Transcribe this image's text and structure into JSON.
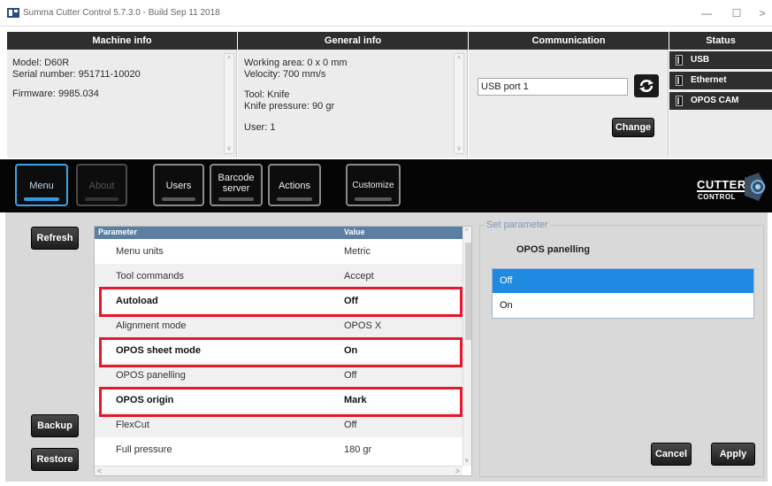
{
  "window": {
    "title": "Summa Cutter Control 5.7.3.0 - Build Sep 11 2018",
    "controls": {
      "minimize": "—",
      "maximize": "☐",
      "close": ">"
    }
  },
  "panels": {
    "machine_info": {
      "header": "Machine info",
      "model": "Model: D60R",
      "serial": "Serial number: 951711-10020",
      "firmware": "Firmware: 9985.034"
    },
    "general_info": {
      "header": "General info",
      "working_area": "Working area: 0 x 0 mm",
      "velocity": "Velocity: 700 mm/s",
      "tool": "Tool: Knife",
      "knife_pressure": "Knife pressure: 90 gr",
      "user": "User: 1"
    },
    "communication": {
      "header": "Communication",
      "port_value": "USB port 1",
      "change_label": "Change"
    },
    "status": {
      "header": "Status",
      "items": [
        "USB",
        "Ethernet",
        "OPOS CAM"
      ]
    }
  },
  "toolbar": {
    "buttons": {
      "menu": "Menu",
      "about": "About",
      "users": "Users",
      "barcode_line1": "Barcode",
      "barcode_line2": "server",
      "actions": "Actions",
      "customize": "Customize"
    },
    "logo_line1": "CUTTER",
    "logo_line2": "CONTROL"
  },
  "side_buttons": {
    "refresh": "Refresh",
    "backup": "Backup",
    "restore": "Restore"
  },
  "table": {
    "headers": {
      "parameter": "Parameter",
      "value": "Value"
    },
    "rows": [
      {
        "parameter": "Menu units",
        "value": "Metric"
      },
      {
        "parameter": "Tool commands",
        "value": "Accept"
      },
      {
        "parameter": "Autoload",
        "value": "Off"
      },
      {
        "parameter": "Alignment mode",
        "value": "OPOS X"
      },
      {
        "parameter": "OPOS sheet mode",
        "value": "On"
      },
      {
        "parameter": "OPOS panelling",
        "value": "Off"
      },
      {
        "parameter": "OPOS origin",
        "value": "Mark"
      },
      {
        "parameter": "FlexCut",
        "value": "Off"
      },
      {
        "parameter": "Full pressure",
        "value": "180 gr"
      }
    ]
  },
  "set_parameter": {
    "legend": "Set parameter",
    "title": "OPOS panelling",
    "options": [
      "Off",
      "On"
    ],
    "selected": "Off",
    "cancel_label": "Cancel",
    "apply_label": "Apply"
  },
  "colors": {
    "highlight": "#e8172a",
    "selection": "#1f8ae0",
    "header_blue": "#5b7fa3"
  }
}
